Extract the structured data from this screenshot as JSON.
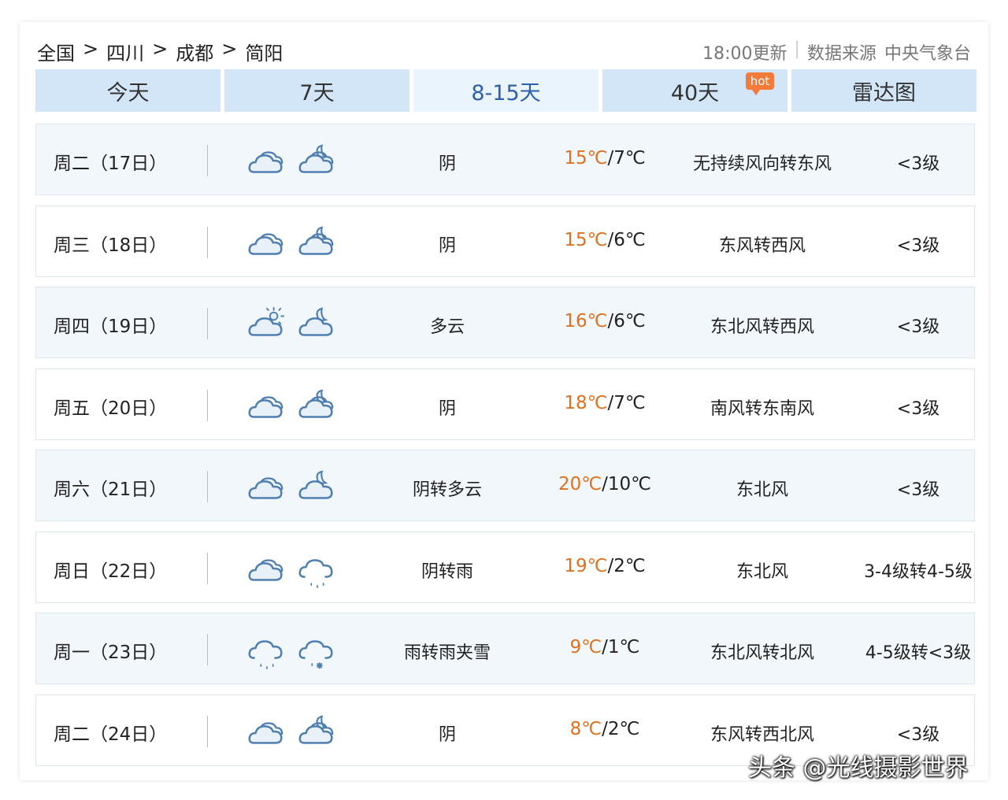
{
  "breadcrumb": [
    "全国",
    "四川",
    "成都",
    "简阳"
  ],
  "breadcrumb_separator": ">",
  "header": {
    "update_time": "18:00更新",
    "source_label": "数据来源",
    "source_name": "中央气象台"
  },
  "tabs": [
    {
      "label": "今天",
      "active": false
    },
    {
      "label": "7天",
      "active": false
    },
    {
      "label": "8-15天",
      "active": true
    },
    {
      "label": "40天",
      "active": false,
      "badge": "hot"
    },
    {
      "label": "雷达图",
      "active": false
    }
  ],
  "forecast": [
    {
      "day": "周二（17日）",
      "icon_day": "cloudy-icon",
      "icon_night": "cloudy-moon-icon",
      "weather": "阴",
      "high": "15℃",
      "low": "7℃",
      "wind": "无持续风向转东风",
      "level": "<3级"
    },
    {
      "day": "周三（18日）",
      "icon_day": "cloudy-icon",
      "icon_night": "cloudy-moon-icon",
      "weather": "阴",
      "high": "15℃",
      "low": "6℃",
      "wind": "东风转西风",
      "level": "<3级"
    },
    {
      "day": "周四（19日）",
      "icon_day": "partly-sunny-icon",
      "icon_night": "partly-cloudy-moon-icon",
      "weather": "多云",
      "high": "16℃",
      "low": "6℃",
      "wind": "东北风转西风",
      "level": "<3级"
    },
    {
      "day": "周五（20日）",
      "icon_day": "cloudy-icon",
      "icon_night": "cloudy-moon-icon",
      "weather": "阴",
      "high": "18℃",
      "low": "7℃",
      "wind": "南风转东南风",
      "level": "<3级"
    },
    {
      "day": "周六（21日）",
      "icon_day": "cloudy-icon",
      "icon_night": "partly-cloudy-moon-icon",
      "weather": "阴转多云",
      "high": "20℃",
      "low": "10℃",
      "wind": "东北风",
      "level": "<3级"
    },
    {
      "day": "周日（22日）",
      "icon_day": "cloudy-icon",
      "icon_night": "rain-icon",
      "weather": "阴转雨",
      "high": "19℃",
      "low": "2℃",
      "wind": "东北风",
      "level": "3-4级转4-5级"
    },
    {
      "day": "周一（23日）",
      "icon_day": "rain-icon",
      "icon_night": "sleet-icon",
      "weather": "雨转雨夹雪",
      "high": "9℃",
      "low": "1℃",
      "wind": "东北风转北风",
      "level": "4-5级转<3级"
    },
    {
      "day": "周二（24日）",
      "icon_day": "cloudy-icon",
      "icon_night": "cloudy-moon-icon",
      "weather": "阴",
      "high": "8℃",
      "low": "2℃",
      "wind": "东风转西北风",
      "level": "<3级"
    }
  ],
  "watermark": "头条 @光线摄影世界",
  "colors": {
    "tab_bg": "#d3e6f7",
    "tab_active_bg": "#eaf4fd",
    "tab_active_text": "#2e5fa8",
    "high_temp": "#e0701e",
    "icon_stroke": "#4f7fb0",
    "hot_badge": "#f47a3a"
  }
}
